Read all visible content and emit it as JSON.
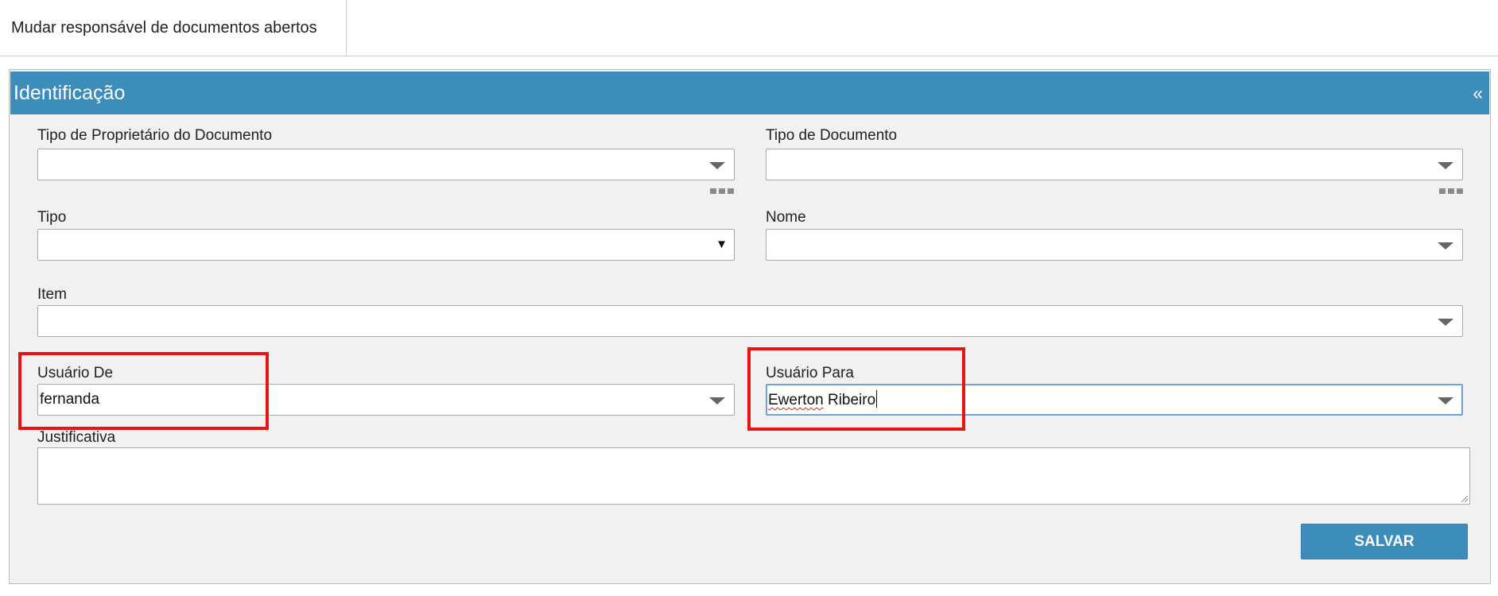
{
  "tabs": [
    {
      "label": "Mudar responsável de documentos abertos"
    }
  ],
  "panel": {
    "title": "Identificação",
    "collapse_symbol": "«"
  },
  "form": {
    "owner_type": {
      "label": "Tipo de Proprietário do Documento",
      "value": ""
    },
    "doc_type": {
      "label": "Tipo de Documento",
      "value": ""
    },
    "tipo": {
      "label": "Tipo",
      "value": "",
      "arrow": "▼"
    },
    "nome": {
      "label": "Nome",
      "value": ""
    },
    "item": {
      "label": "Item",
      "value": ""
    },
    "user_from": {
      "label": "Usuário De",
      "value": "fernanda"
    },
    "user_to": {
      "label": "Usuário Para",
      "value_misspelled": "Ewerton",
      "value_rest": " Ribeiro"
    },
    "justificativa": {
      "label": "Justificativa",
      "value": ""
    }
  },
  "buttons": {
    "save_label": "SALVAR"
  },
  "colors": {
    "header_blue": "#3c8dbc",
    "highlight_red": "#ee1111",
    "focus_blue": "#6fa3de"
  },
  "icons": {
    "dropdown": "chevron-down-icon",
    "more": "more-options-icon",
    "collapse": "collapse-icon"
  }
}
